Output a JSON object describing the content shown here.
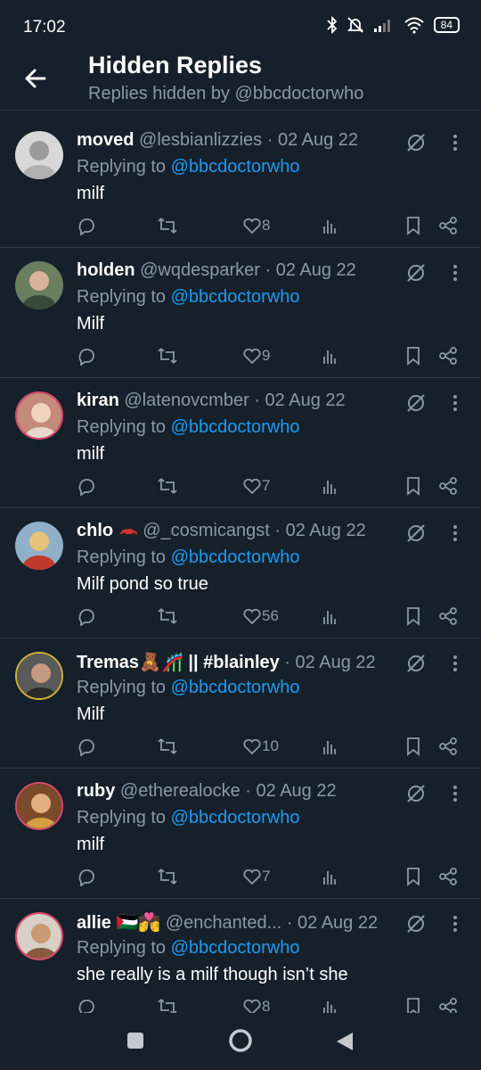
{
  "status": {
    "time": "17:02",
    "battery": "84"
  },
  "header": {
    "title": "Hidden Replies",
    "subtitle": "Replies hidden by @bbcdoctorwho"
  },
  "tweets": [
    {
      "name": "moved",
      "handle": "@lesbianlizzies",
      "date": "· 02 Aug 22",
      "replying_prefix": "Replying to",
      "mention": "@bbcdoctorwho",
      "text": "milf",
      "likes": "8"
    },
    {
      "name": "holden",
      "handle": "@wqdesparker",
      "date": "· 02 Aug 22",
      "replying_prefix": "Replying to",
      "mention": "@bbcdoctorwho",
      "text": "Milf",
      "likes": "9"
    },
    {
      "name": "kiran",
      "handle": "@latenovcmber",
      "date": "· 02 Aug 22",
      "replying_prefix": "Replying to",
      "mention": "@bbcdoctorwho",
      "text": "milf",
      "likes": "7"
    },
    {
      "name": "chlo",
      "handle": "@_cosmicangst",
      "date": "· 02 Aug 22",
      "replying_prefix": "Replying to",
      "mention": "@bbcdoctorwho",
      "text": "Milf pond so true",
      "likes": "56"
    },
    {
      "name": "Tremas🧸🎢 || #blainley",
      "handle": "",
      "date": "· 02 Aug 22",
      "replying_prefix": "Replying to",
      "mention": "@bbcdoctorwho",
      "text": "Milf",
      "likes": "10"
    },
    {
      "name": "ruby",
      "handle": "@etherealocke",
      "date": "· 02 Aug 22",
      "replying_prefix": "Replying to",
      "mention": "@bbcdoctorwho",
      "text": "milf",
      "likes": "7"
    },
    {
      "name": "allie 🇵🇸💏",
      "handle": "@enchanted...",
      "date": "· 02 Aug 22",
      "replying_prefix": "Replying to",
      "mention": "@bbcdoctorwho",
      "text": "she really is a milf though isn’t she",
      "likes": "8"
    }
  ],
  "colors": {
    "background": "#15202b",
    "accent": "#1d9bf0",
    "muted": "#8b98a5"
  }
}
